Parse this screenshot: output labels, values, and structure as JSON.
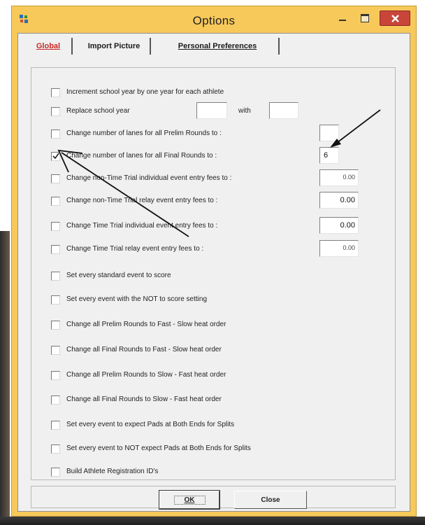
{
  "window": {
    "title": "Options",
    "controls": {
      "minimize": "minimize",
      "maximize": "maximize",
      "close": "close"
    }
  },
  "tabs": [
    {
      "label": "Global",
      "active": true
    },
    {
      "label": "Import Picture",
      "active": false
    },
    {
      "label": "Personal Preferences",
      "active": false
    }
  ],
  "options": [
    {
      "label": "Increment school year by one year for each athlete",
      "checked": false
    },
    {
      "label": "Replace school year",
      "checked": false,
      "field_a": "",
      "with_label": "with",
      "field_b": ""
    },
    {
      "label": "Change number of lanes for all Prelim Rounds to :",
      "checked": false,
      "value": ""
    },
    {
      "label": "Change number of lanes for all Final Rounds to :",
      "checked": true,
      "value": "6"
    },
    {
      "label": "Change non-Time Trial individual event entry fees to :",
      "checked": false,
      "value": "0.00"
    },
    {
      "label": "Change non-Time Trial relay event entry fees to :",
      "checked": false,
      "value": "0.00"
    },
    {
      "label": "Change Time Trial individual event entry fees to :",
      "checked": false,
      "value": "0.00"
    },
    {
      "label": "Change Time Trial relay event entry fees to :",
      "checked": false,
      "value": "0.00"
    },
    {
      "label": "Set every standard event to score",
      "checked": false
    },
    {
      "label": "Set every event with the NOT to score setting",
      "checked": false
    },
    {
      "label": "Change all Prelim Rounds to Fast - Slow heat order",
      "checked": false
    },
    {
      "label": "Change all Final Rounds to Fast - Slow heat order",
      "checked": false
    },
    {
      "label": "Change all Prelim Rounds to Slow - Fast heat order",
      "checked": false
    },
    {
      "label": "Change all Final Rounds to Slow - Fast heat order",
      "checked": false
    },
    {
      "label": "Set every event to expect Pads at Both Ends for Splits",
      "checked": false
    },
    {
      "label": "Set every event to NOT expect Pads at Both Ends for Splits",
      "checked": false
    },
    {
      "label": "Build Athlete Registration ID's",
      "checked": false
    }
  ],
  "buttons": {
    "ok": "OK",
    "close": "Close"
  },
  "colors": {
    "title_bar": "#f7c95a",
    "close_button": "#c9453a",
    "active_tab": "#c62828",
    "dialog_bg": "#f0f0f0"
  }
}
